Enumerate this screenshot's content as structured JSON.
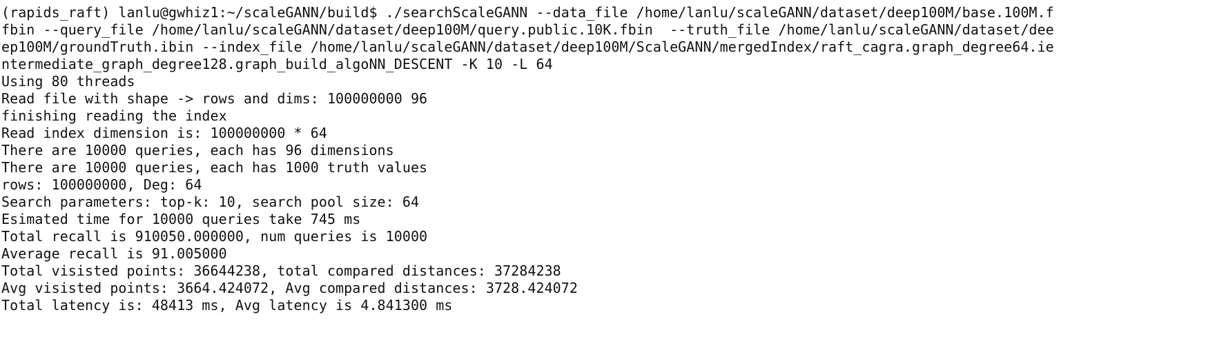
{
  "terminal": {
    "lines": [
      "(rapids_raft) lanlu@gwhiz1:~/scaleGANN/build$ ./searchScaleGANN --data_file /home/lanlu/scaleGANN/dataset/deep100M/base.100M.f",
      "fbin --query_file /home/lanlu/scaleGANN/dataset/deep100M/query.public.10K.fbin  --truth_file /home/lanlu/scaleGANN/dataset/dee",
      "ep100M/groundTruth.ibin --index_file /home/lanlu/scaleGANN/dataset/deep100M/ScaleGANN/mergedIndex/raft_cagra.graph_degree64.ie",
      "ntermediate_graph_degree128.graph_build_algoNN_DESCENT -K 10 -L 64",
      "Using 80 threads",
      "Read file with shape -> rows and dims: 100000000 96",
      "finishing reading the index",
      "Read index dimension is: 100000000 * 64",
      "There are 10000 queries, each has 96 dimensions",
      "There are 10000 queries, each has 1000 truth values",
      "rows: 100000000, Deg: 64",
      "Search parameters: top-k: 10, search pool size: 64",
      "Esimated time for 10000 queries take 745 ms",
      "Total recall is 910050.000000, num queries is 10000",
      "Average recall is 91.005000",
      "Total visisted points: 36644238, total compared distances: 37284238",
      "Avg visisted points: 3664.424072, Avg compared distances: 3728.424072",
      "Total latency is: 48413 ms, Avg latency is 4.841300 ms"
    ]
  }
}
